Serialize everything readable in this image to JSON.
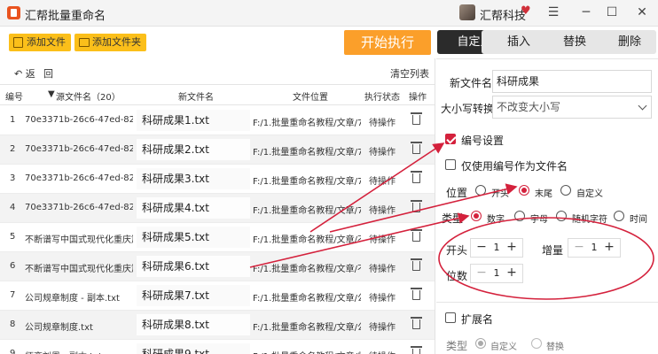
{
  "window": {
    "title": "汇帮批量重命名",
    "brand": "汇帮科技",
    "minimize": "☰",
    "restore": "─",
    "maximize": "☐",
    "close": "✕"
  },
  "toolbar": {
    "add_file": "添加文件",
    "add_folder": "添加文件夹",
    "start": "开始执行",
    "back": "返",
    "undo": "回",
    "clear_list": "清空列表"
  },
  "table": {
    "headers": {
      "index": "编号",
      "source": "源文件名（20）",
      "new_name": "新文件名",
      "location": "文件位置",
      "status": "执行状态",
      "action": "操作"
    },
    "rows": [
      {
        "index": "1",
        "source": "70e3371b-26c6-47ed-82ba-3e7",
        "new_name": "科研成果1.txt",
        "location": "F:/1.批量重命名教程/文章/70e337",
        "status": "待操作"
      },
      {
        "index": "2",
        "source": "70e3371b-26c6-47ed-82ba-3e7",
        "new_name": "科研成果2.txt",
        "location": "F:/1.批量重命名教程/文章/70e337",
        "status": "待操作"
      },
      {
        "index": "3",
        "source": "70e3371b-26c6-47ed-82ba-3e7",
        "new_name": "科研成果3.txt",
        "location": "F:/1.批量重命名教程/文章/70e337",
        "status": "待操作"
      },
      {
        "index": "4",
        "source": "70e3371b-26c6-47ed-82ba-3e7",
        "new_name": "科研成果4.txt",
        "location": "F:/1.批量重命名教程/文章/70e337",
        "status": "待操作"
      },
      {
        "index": "5",
        "source": "不断谱写中国式现代化重庆篇章 - |",
        "new_name": "科研成果5.txt",
        "location": "F:/1.批量重命名教程/文章/不断谱",
        "status": "待操作"
      },
      {
        "index": "6",
        "source": "不断谱写中国式现代化重庆篇章.txt",
        "new_name": "科研成果6.txt",
        "location": "F:/1.批量重命名教程/文章/不断谱",
        "status": "待操作"
      },
      {
        "index": "7",
        "source": "公司规章制度 - 副本.txt",
        "new_name": "科研成果7.txt",
        "location": "F:/1.批量重命名教程/文章/公司规",
        "status": "待操作"
      },
      {
        "index": "8",
        "source": "公司规章制度.txt",
        "new_name": "科研成果8.txt",
        "location": "F:/1.批量重命名教程/文章/公司规",
        "status": "待操作"
      },
      {
        "index": "9",
        "source": "师恋刘恩 - 副本.txt",
        "new_name": "科研成果9.txt",
        "location": "F:/1.批量重命名教程/文章/师恋",
        "status": "待操作"
      }
    ]
  },
  "tabs": [
    "自定义",
    "插入",
    "替换",
    "删除"
  ],
  "panel": {
    "new_name_label": "新文件名",
    "new_name_value": "科研成果",
    "case_label": "大小写转换",
    "case_value": "不改变大小写",
    "numbering_label": "编号设置",
    "numbering_only_label": "仅使用编号作为文件名",
    "position_label": "位置",
    "position_options": [
      "开头",
      "末尾",
      "自定义"
    ],
    "type_label": "类型",
    "type_options": [
      "数字",
      "字母",
      "随机字符",
      "时间"
    ],
    "start_label": "开头",
    "start_value": "1",
    "increment_label": "增量",
    "increment_value": "1",
    "digits_label": "位数",
    "digits_value": "1",
    "extension_label": "扩展名",
    "ext_type_label": "类型",
    "ext_type_options": [
      "自定义",
      "替换"
    ]
  },
  "colors": {
    "accent_red": "#d4213c",
    "button_yellow": "#fbbf1a",
    "start_orange": "#fb9f2a",
    "tab_active": "#2b2b2b"
  }
}
